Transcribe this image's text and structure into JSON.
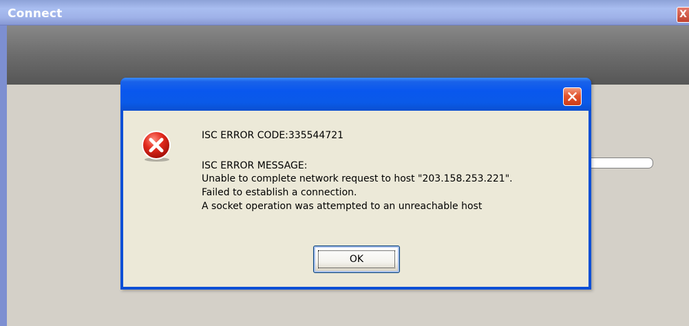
{
  "background_window": {
    "title": "Connect",
    "close_glyph": "X"
  },
  "dialog": {
    "title": "",
    "icon": "error-icon",
    "error_code_line": "ISC ERROR CODE:335544721",
    "message_heading": "ISC ERROR MESSAGE:",
    "message_lines": [
      "Unable to complete network request to host \"203.158.253.221\".",
      "Failed to establish a connection.",
      "A socket operation was attempted to an unreachable host"
    ],
    "ok_label": "OK"
  },
  "colors": {
    "dialog_title_blue": "#0a5ae8",
    "dialog_body": "#ece9d8",
    "close_button_red": "#e3552f",
    "error_icon_red": "#d6241b",
    "bg_window_body": "#d4d0c8"
  }
}
